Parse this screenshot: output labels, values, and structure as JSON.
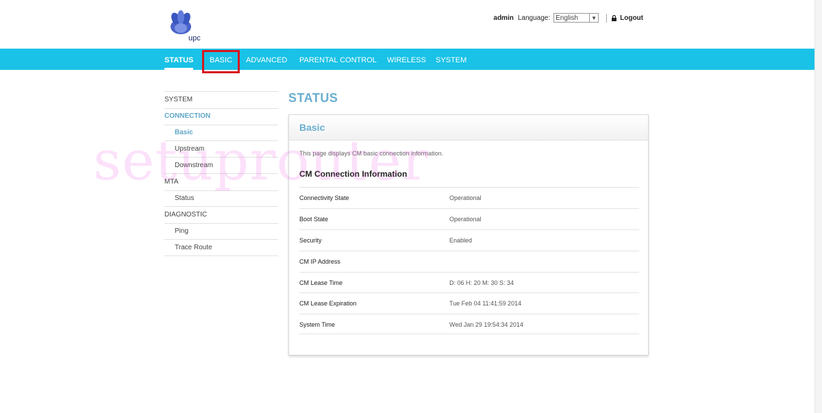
{
  "brand": {
    "logo_text": "upc"
  },
  "topbar": {
    "user": "admin",
    "language_label": "Language:",
    "language_value": "English",
    "logout": "Logout"
  },
  "nav": [
    {
      "label": "STATUS"
    },
    {
      "label": "BASIC"
    },
    {
      "label": "ADVANCED"
    },
    {
      "label": "PARENTAL CONTROL"
    },
    {
      "label": "WIRELESS"
    },
    {
      "label": "SYSTEM"
    }
  ],
  "sidebar": [
    {
      "label": "SYSTEM"
    },
    {
      "label": "CONNECTION"
    },
    {
      "label": "Basic"
    },
    {
      "label": "Upstream"
    },
    {
      "label": "Downstream"
    },
    {
      "label": "MTA"
    },
    {
      "label": "Status"
    },
    {
      "label": "DIAGNOSTIC"
    },
    {
      "label": "Ping"
    },
    {
      "label": "Trace Route"
    }
  ],
  "main": {
    "page_title": "STATUS",
    "panel_title": "Basic",
    "description": "This page displays CM basic connection information.",
    "section_title": "CM Connection Information",
    "rows": [
      {
        "key": "Connectivity State",
        "value": "Operational"
      },
      {
        "key": "Boot State",
        "value": "Operational"
      },
      {
        "key": "Security",
        "value": "Enabled"
      },
      {
        "key": "CM IP Address",
        "value": ""
      },
      {
        "key": "CM Lease Time",
        "value": "D: 06 H: 20 M: 30 S: 34"
      },
      {
        "key": "CM Lease Expiration",
        "value": "Tue Feb 04 11:41:59 2014"
      },
      {
        "key": "System Time",
        "value": "Wed Jan 29 19:54:34 2014"
      }
    ]
  },
  "watermark": "setuprouter",
  "colors": {
    "nav_bar": "#19c2e6",
    "accent": "#6aaed0",
    "highlight": "#d6171f"
  }
}
